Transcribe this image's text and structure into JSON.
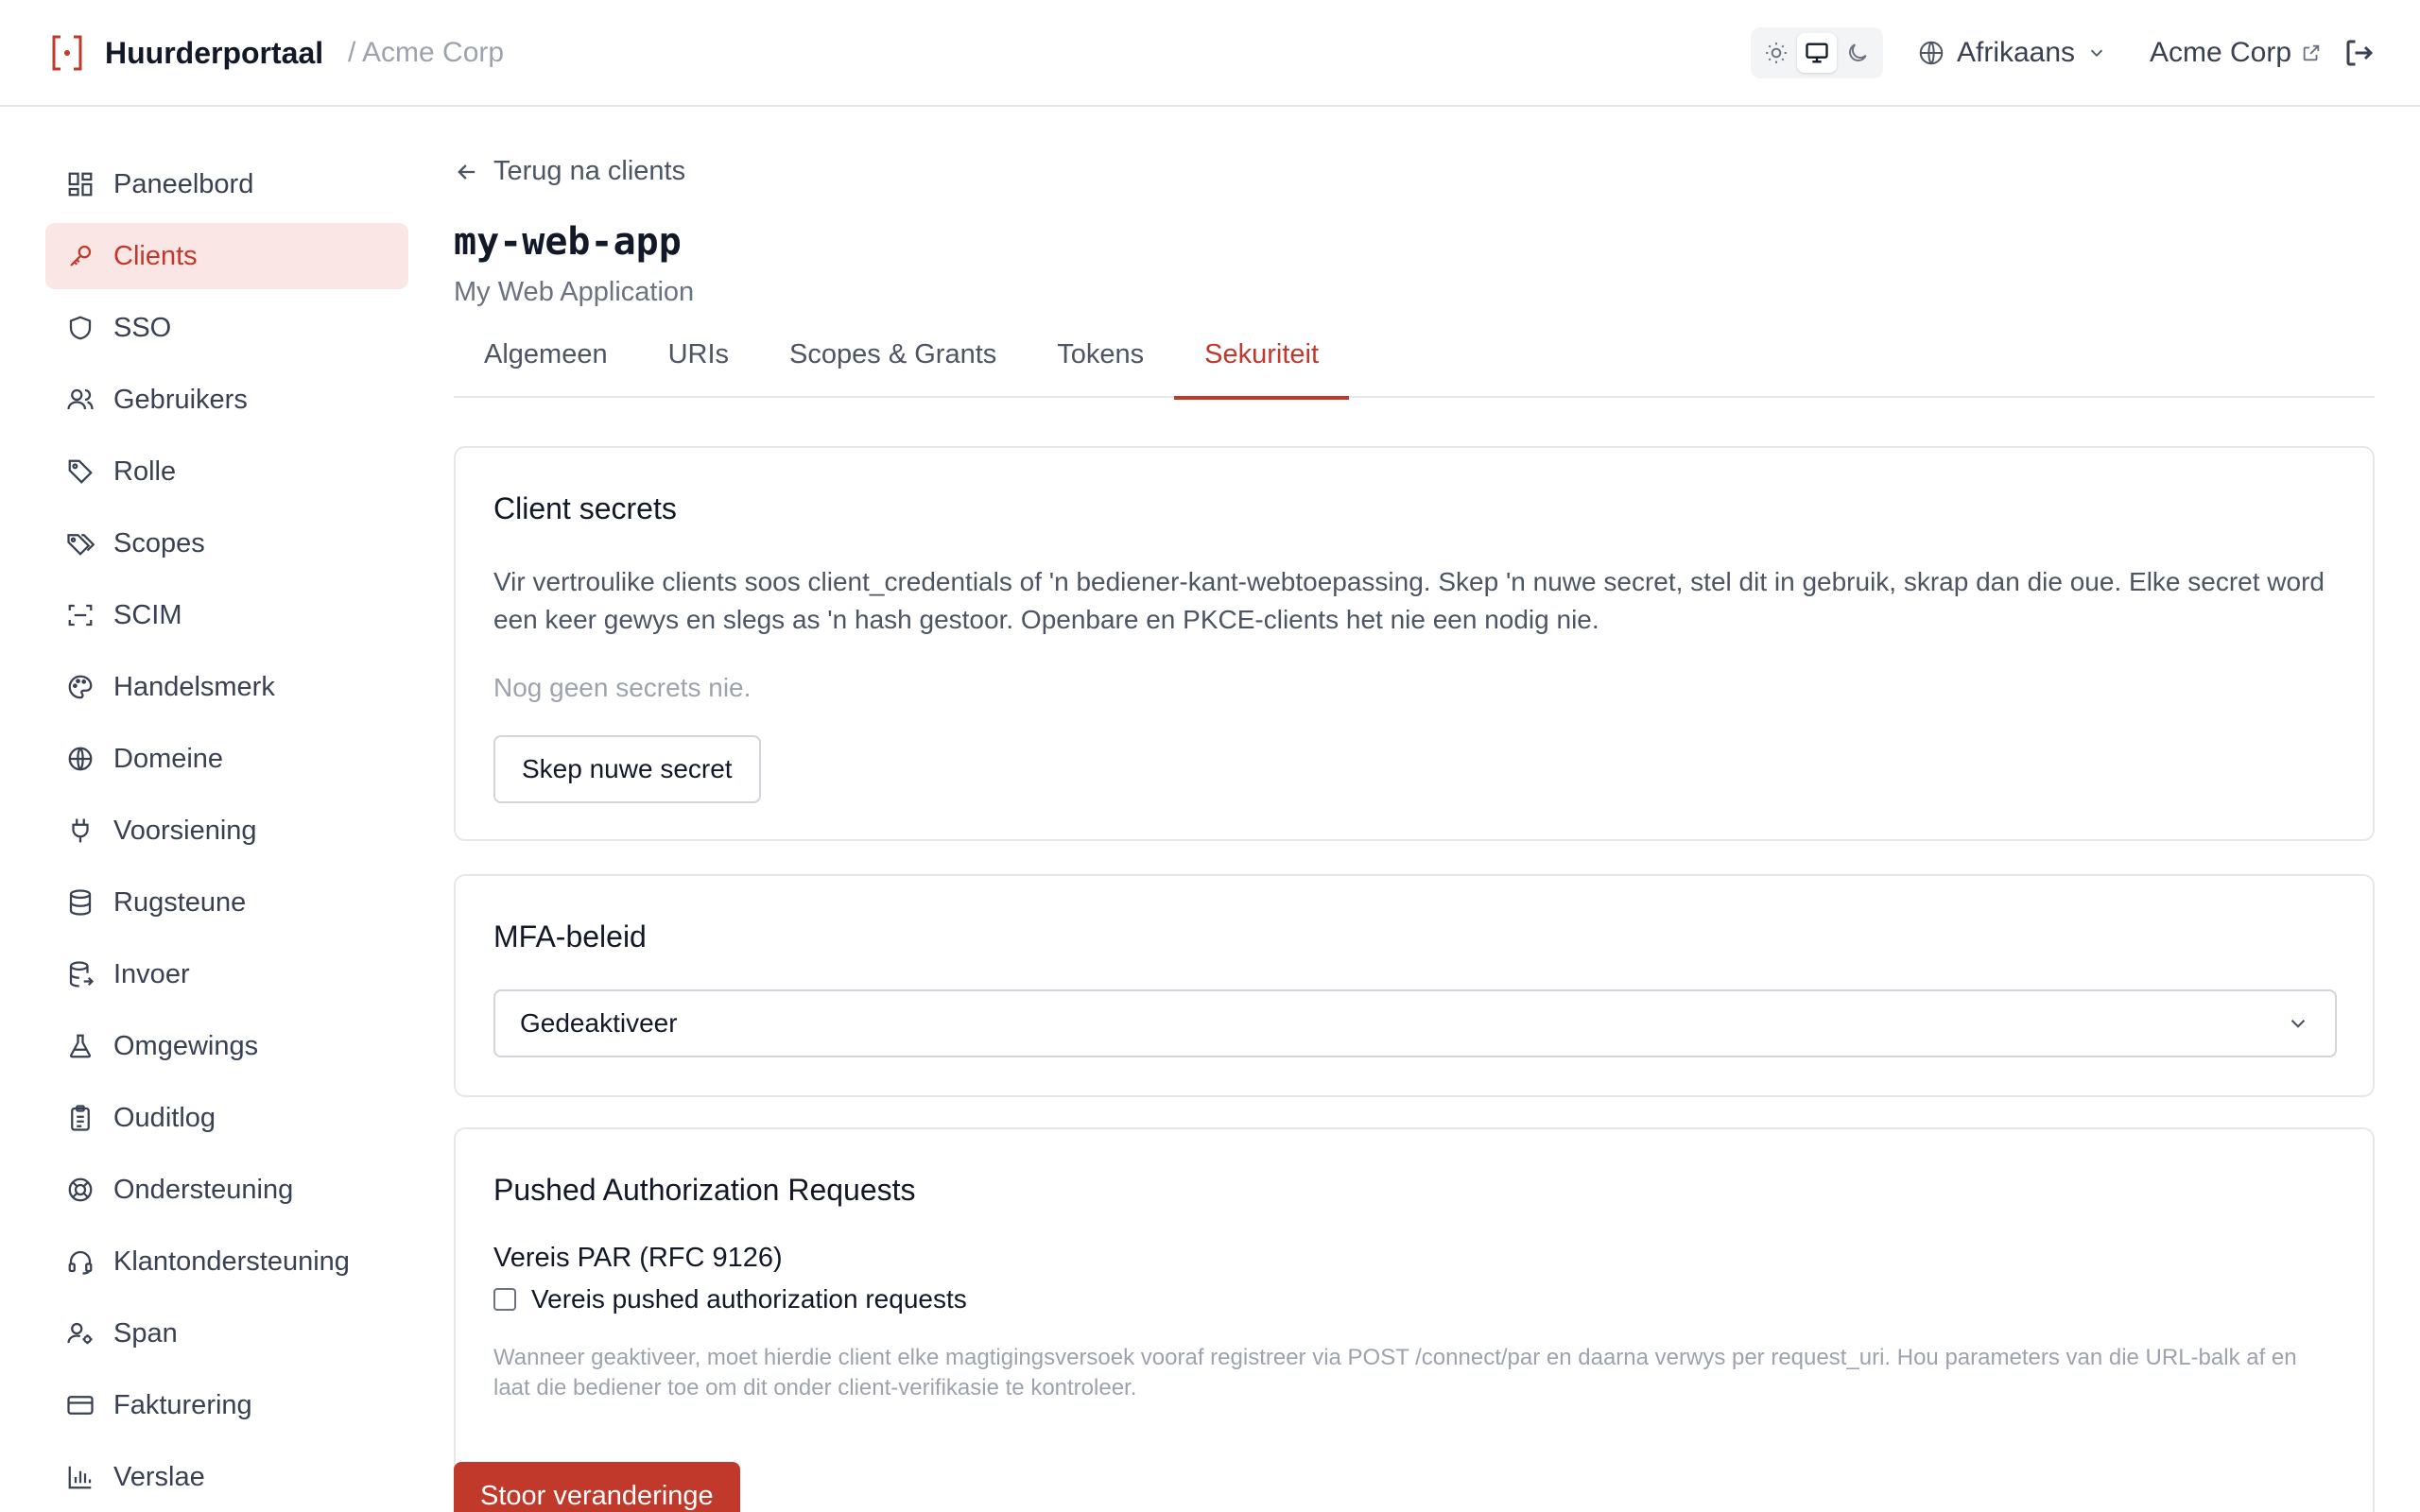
{
  "header": {
    "brand_name": "Huurderportaal",
    "tenant_crumb": "/ Acme Corp",
    "language": "Afrikaans",
    "tenant_link": "Acme Corp",
    "theme_modes": [
      "light",
      "system",
      "dark"
    ],
    "active_theme": "system"
  },
  "sidebar": {
    "items": [
      {
        "label": "Paneelbord",
        "icon": "dashboard-icon"
      },
      {
        "label": "Clients",
        "icon": "key-icon",
        "active": true
      },
      {
        "label": "SSO",
        "icon": "shield-icon"
      },
      {
        "label": "Gebruikers",
        "icon": "users-icon"
      },
      {
        "label": "Rolle",
        "icon": "tag-icon"
      },
      {
        "label": "Scopes",
        "icon": "tags-icon"
      },
      {
        "label": "SCIM",
        "icon": "scan-icon"
      },
      {
        "label": "Handelsmerk",
        "icon": "palette-icon"
      },
      {
        "label": "Domeine",
        "icon": "globe-icon"
      },
      {
        "label": "Voorsiening",
        "icon": "plug-icon"
      },
      {
        "label": "Rugsteune",
        "icon": "database-icon"
      },
      {
        "label": "Invoer",
        "icon": "database-import-icon"
      },
      {
        "label": "Omgewings",
        "icon": "flask-icon"
      },
      {
        "label": "Ouditlog",
        "icon": "clipboard-icon"
      },
      {
        "label": "Ondersteuning",
        "icon": "lifebuoy-icon"
      },
      {
        "label": "Klantondersteuning",
        "icon": "headset-icon"
      },
      {
        "label": "Span",
        "icon": "user-cog-icon"
      },
      {
        "label": "Fakturering",
        "icon": "credit-card-icon"
      },
      {
        "label": "Verslae",
        "icon": "bar-chart-icon"
      }
    ]
  },
  "main": {
    "back_label": "Terug na clients",
    "client_id": "my-web-app",
    "client_name": "My Web Application",
    "tabs": [
      {
        "label": "Algemeen"
      },
      {
        "label": "URIs"
      },
      {
        "label": "Scopes & Grants"
      },
      {
        "label": "Tokens"
      },
      {
        "label": "Sekuriteit",
        "active": true
      }
    ],
    "secrets_card": {
      "title": "Client secrets",
      "description": "Vir vertroulike clients soos client_credentials of 'n bediener-kant-webtoepassing. Skep 'n nuwe secret, stel dit in gebruik, skrap dan die oue. Elke secret word een keer gewys en slegs as 'n hash gestoor. Openbare en PKCE-clients het nie een nodig nie.",
      "empty_text": "Nog geen secrets nie.",
      "create_button": "Skep nuwe secret"
    },
    "mfa_card": {
      "title": "MFA-beleid",
      "selected": "Gedeaktiveer"
    },
    "par_card": {
      "title": "Pushed Authorization Requests",
      "field_label": "Vereis PAR (RFC 9126)",
      "checkbox_label": "Vereis pushed authorization requests",
      "checked": false,
      "help_text": "Wanneer geaktiveer, moet hierdie client elke magtigingsversoek vooraf registreer via POST /connect/par en daarna verwys per request_uri. Hou parameters van die URL-balk af en laat die bediener toe om dit onder client-verifikasie te kontroleer."
    },
    "save_button": "Stoor veranderinge"
  },
  "colors": {
    "accent": "#c0392b",
    "accent_bg": "#fbe6e6",
    "border": "#e5e7eb"
  }
}
